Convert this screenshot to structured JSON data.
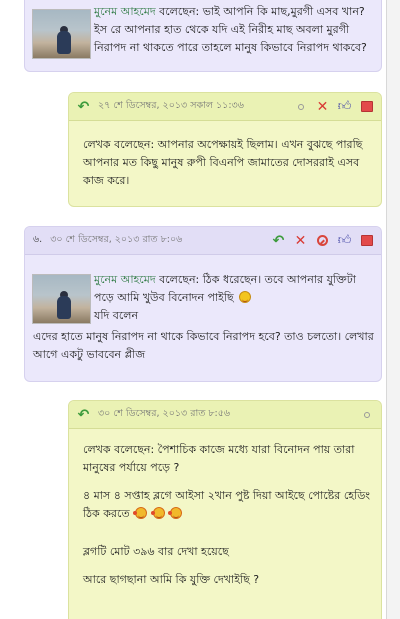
{
  "comments": [
    {
      "id": "c1",
      "name": "মুনেম আহমেদ",
      "says": "বলেছেন:",
      "lines": [
        "ভাই আপনি কি মাছ,মুরগী এসব খান?",
        "ইস রে আপনার হাত থেকে যদি এই নিরীহ মাছ অবলা মুরগী",
        "নিরাপদ না থাকতে পারে তাহলে মানুষ কিভাবে নিরাপদ থাকবে?"
      ]
    },
    {
      "id": "c2",
      "header_meta": "২৭ শে ডিসেম্বর, ২০১৩ সকাল ১১:৩৬",
      "lines": [
        "লেখক বলেছেন: আপনার অপেক্ষায়ই ছিলাম। এখন বুঝছে পারছি",
        "আপনার মত কিছু মানুষ রুপী বিএনপি জামাতের দোসররাই এসব",
        "কাজ করে।"
      ]
    },
    {
      "id": "c3",
      "header_num": "৬.",
      "header_meta": "৩০ শে ডিসেম্বর, ২০১৩ রাত ৮:০৬",
      "name": "মুনেম আহমেদ",
      "says": "বলেছেন:",
      "line1": "ঠিক ধরেছেন। তবে আপনার যুক্তিটা",
      "line2": "পড়ে আমি খুউব বিনোদন পাইছি",
      "line3": "যদি বলেন",
      "lines_full": [
        "এদের হাতে মানুষ নিরাপদ না থাকে কিভাবে নিরাপদ হবে? তাও চলতো। লেখার",
        "আগে একটু ভাববেন প্লীজ"
      ]
    },
    {
      "id": "c4",
      "header_meta": "৩০ শে ডিসেম্বর, ২০১৩ রাত ৮:৫৬",
      "para1": [
        "লেখক বলেছেন: পৈশাচিক কাজে মধ্যে যারা বিনোদন পায় তারা",
        "মানুষের পর্যায়ে পড়ে ?"
      ],
      "para2": [
        "৪ মাস ৪ সপ্তাহ ব্লগে আইসা ২খান পুষ্ট দিয়া আইছে পোষ্টের হেডিং",
        "ঠিক করতে"
      ],
      "para3": "ব্লগটি মোট ৩৯৬ বার দেখা হয়েছে",
      "para4": "আরে ছাগছানা আমি কি যুক্তি দেখাইছি ?"
    }
  ],
  "icons": {
    "reply": "reply-arrow-icon",
    "delete": "delete-x-icon",
    "block": "block-icon",
    "like": "thumb-icon",
    "report": "report-mail-icon",
    "toggle": "circle-icon",
    "smiley": "laughing-smiley-icon"
  },
  "colors": {
    "lavender": "#ebe8fb",
    "yellow": "#f3f7c7",
    "name_green": "#2f7a44",
    "reply_green": "#3c9b3c",
    "delete_red": "#d93b35"
  }
}
